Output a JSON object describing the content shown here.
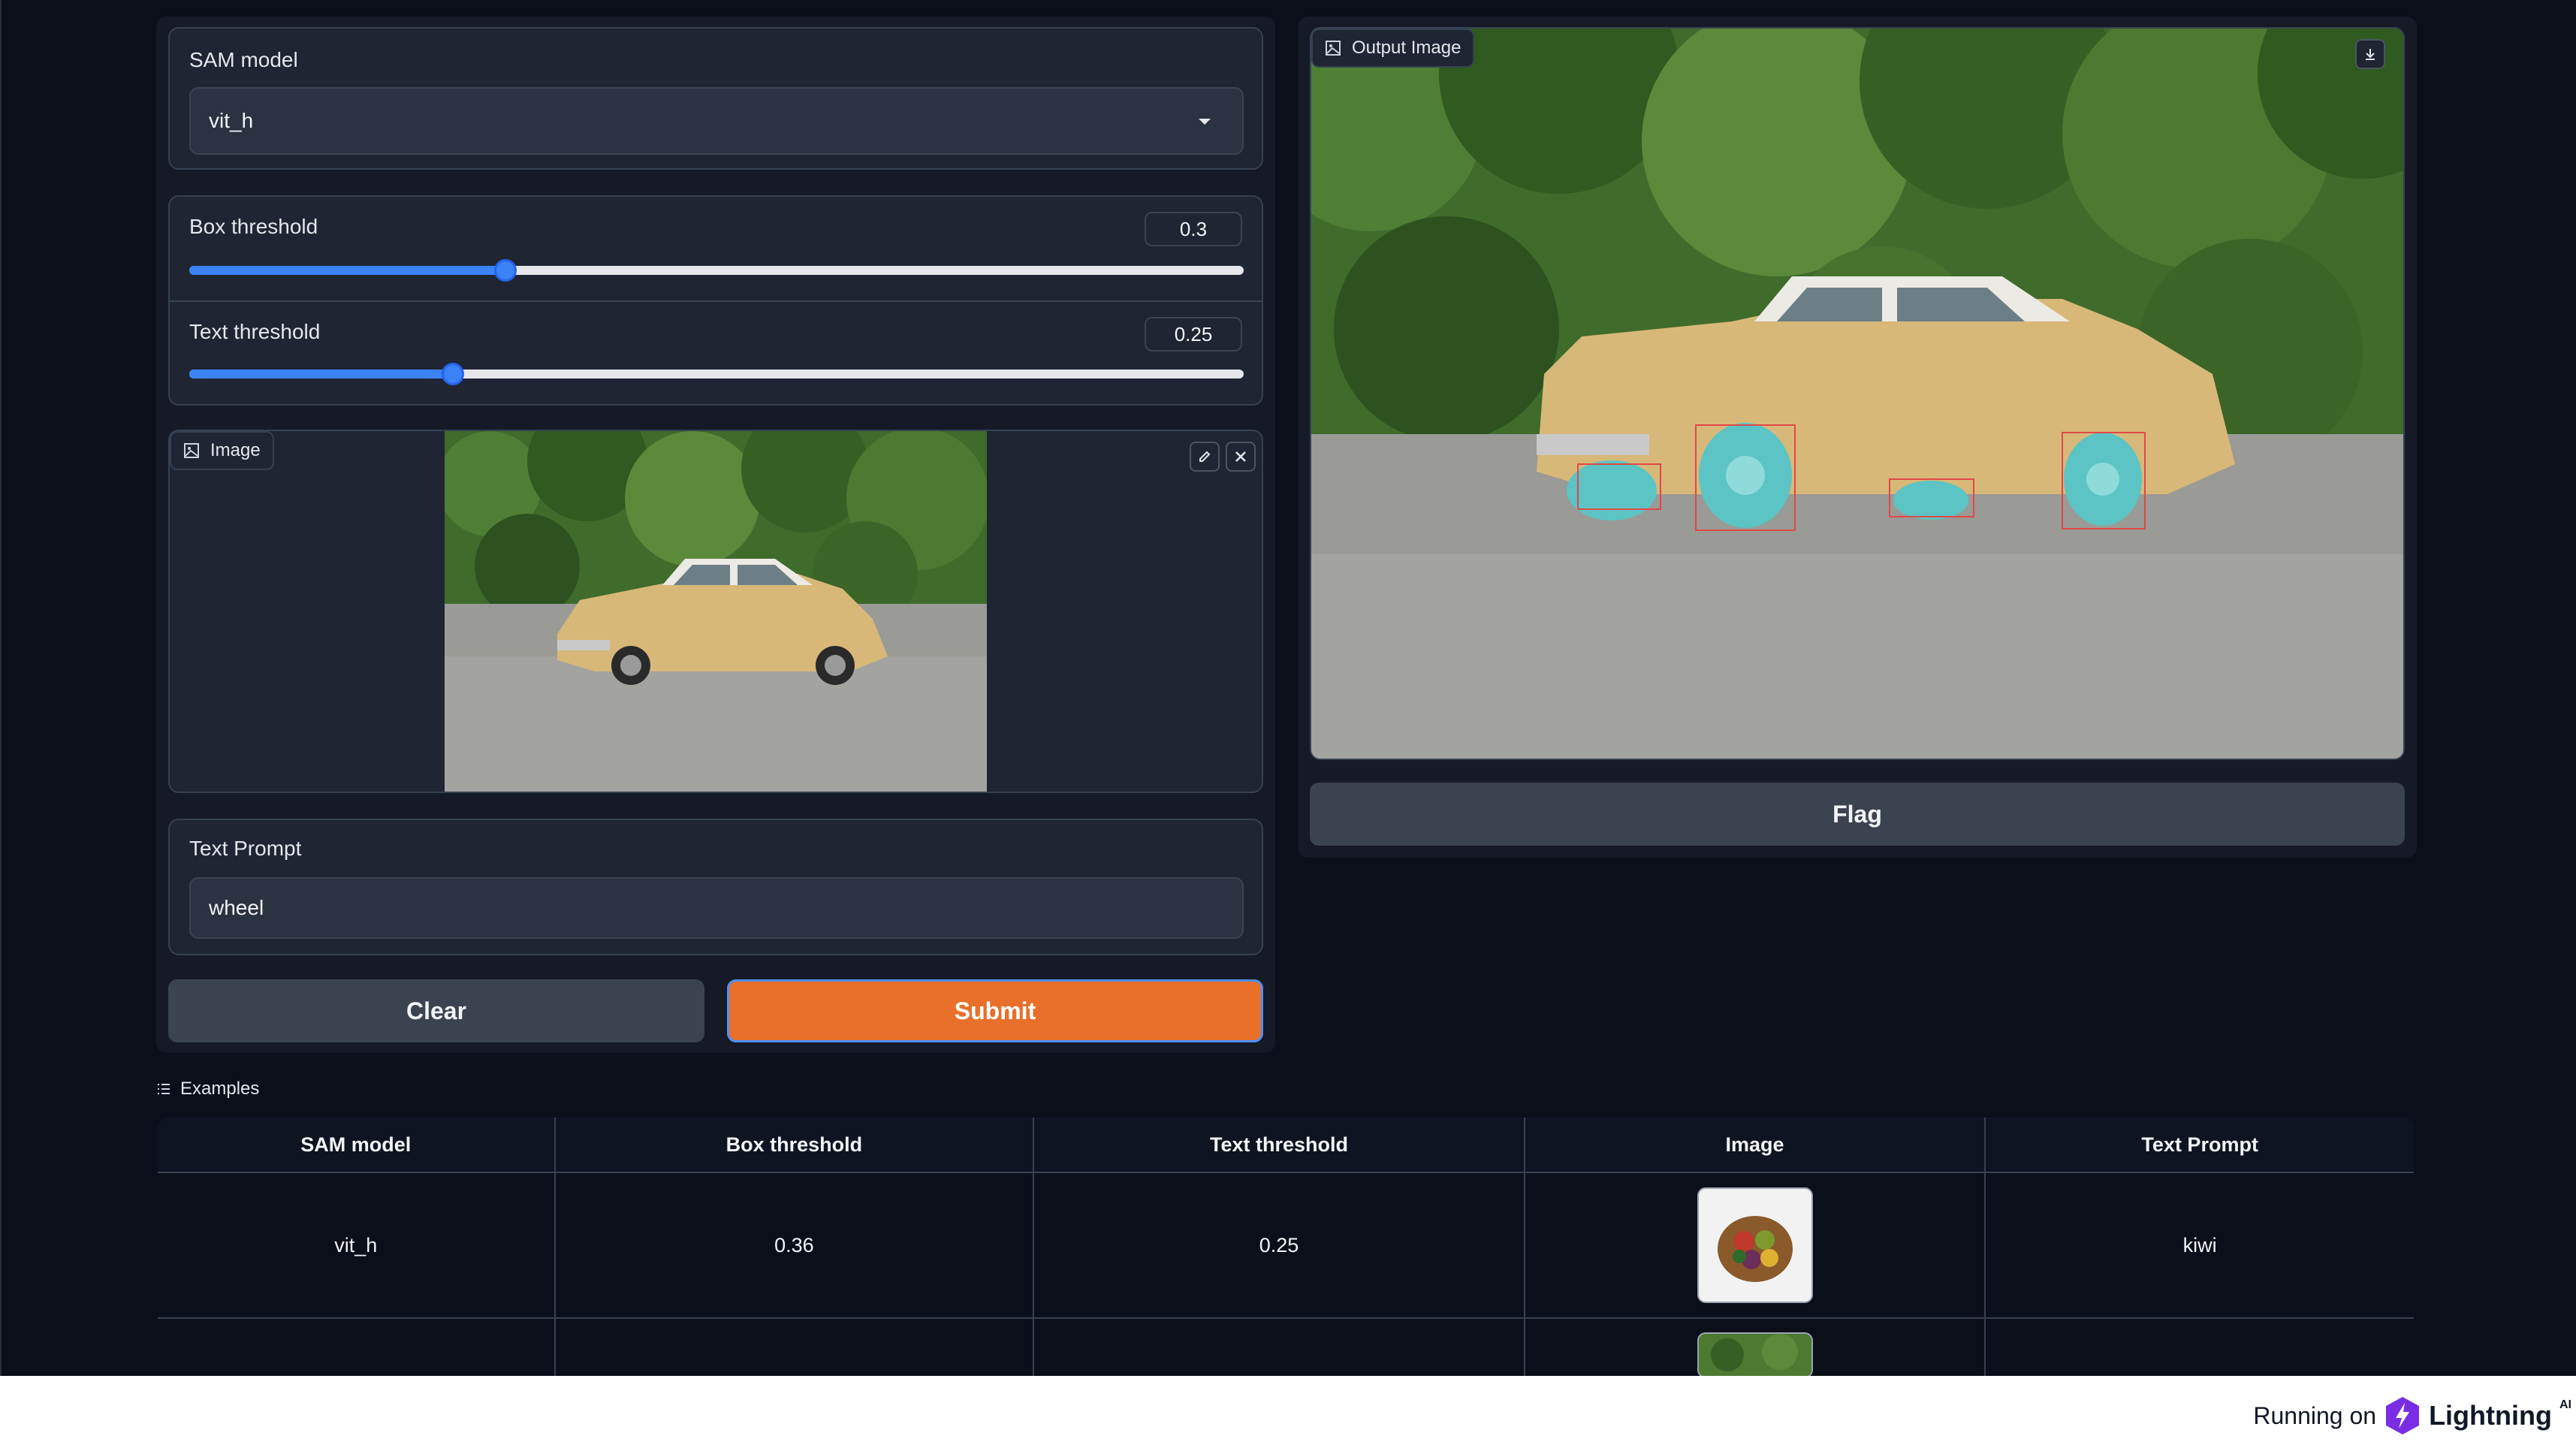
{
  "inputs": {
    "sam_model": {
      "label": "SAM model",
      "value": "vit_h"
    },
    "box_threshold": {
      "label": "Box threshold",
      "value": "0.3",
      "level": 0.3
    },
    "text_threshold": {
      "label": "Text threshold",
      "value": "0.25",
      "level": 0.25
    },
    "image": {
      "label": "Image"
    },
    "text_prompt": {
      "label": "Text Prompt",
      "value": "wheel"
    },
    "clear_label": "Clear",
    "submit_label": "Submit"
  },
  "output": {
    "label": "Output Image",
    "flag_label": "Flag"
  },
  "examples": {
    "label": "Examples",
    "headers": [
      "SAM model",
      "Box threshold",
      "Text threshold",
      "Image",
      "Text Prompt"
    ],
    "rows": [
      {
        "sam_model": "vit_h",
        "box_threshold": "0.36",
        "text_threshold": "0.25",
        "text_prompt": "kiwi"
      }
    ]
  },
  "footer": {
    "running_on": "Running on",
    "brand": "Lightning",
    "brand_suffix": "AI"
  },
  "colors": {
    "accent_blue": "#3b82f6",
    "submit_orange": "#e8702a",
    "background": "#0b0f19"
  }
}
